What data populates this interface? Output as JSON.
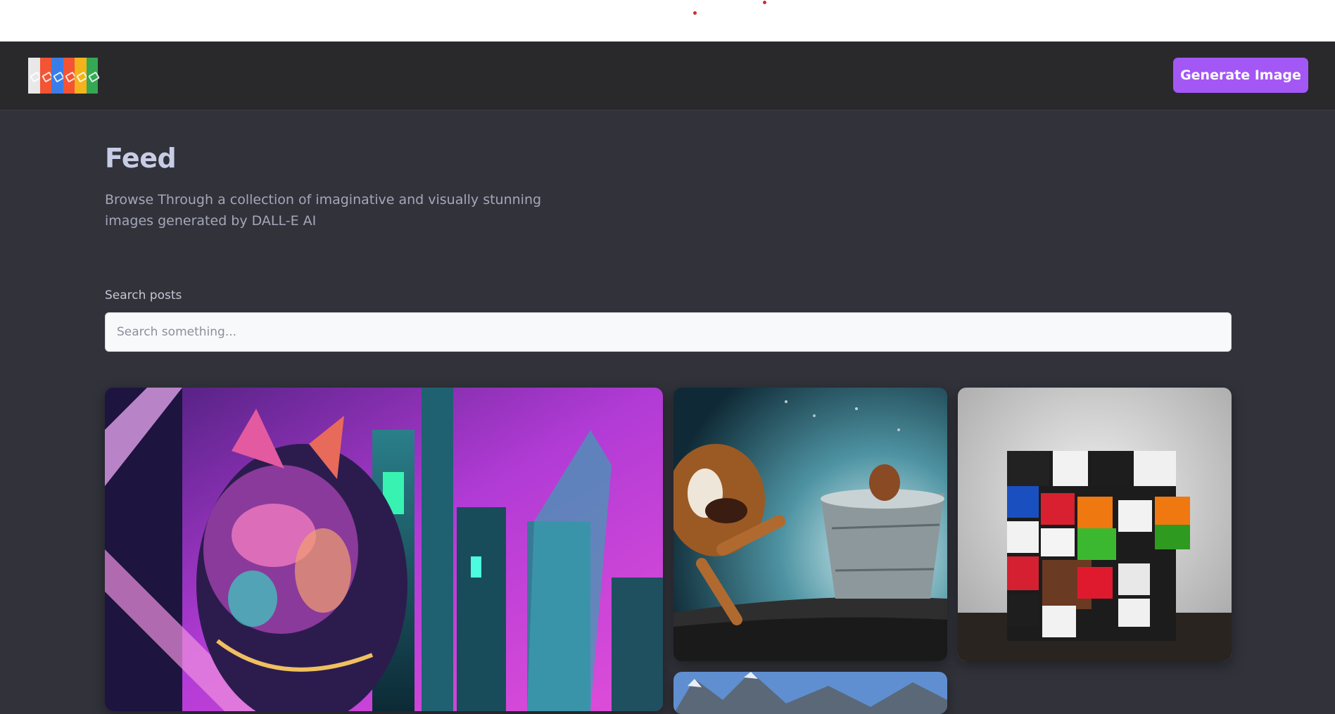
{
  "header": {
    "logo_colors": [
      "#e8e8e8",
      "#f25434",
      "#3a7de8",
      "#f25434",
      "#f4b21c",
      "#34a853"
    ],
    "generate_button_label": "Generate Image",
    "accent_color": "#a357f5"
  },
  "main": {
    "title": "Feed",
    "description": "Browse Through a collection of imaginative and visually stunning images generated by DALL-E AI"
  },
  "search": {
    "label": "Search posts",
    "placeholder": "Search something...",
    "value": ""
  },
  "feed": {
    "cards": [
      {
        "image": "neon-cyberpunk-cat-city"
      },
      {
        "image": "dog-jumping-into-bucket"
      },
      {
        "image": "rubiks-cube-food"
      },
      {
        "image": "mountain-landscape"
      }
    ]
  }
}
